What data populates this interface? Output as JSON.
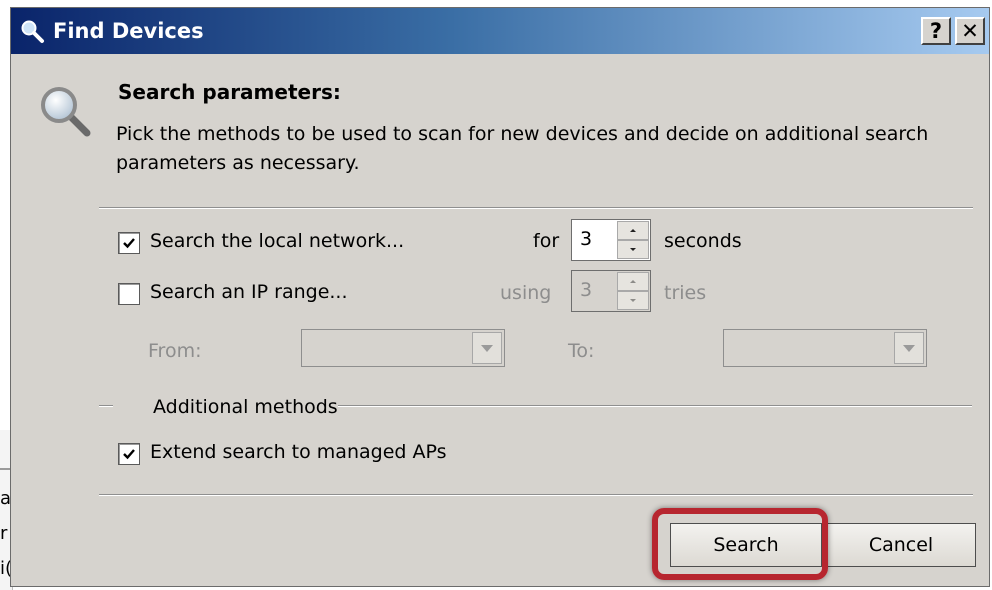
{
  "window": {
    "title": "Find Devices",
    "help_glyph": "?",
    "close_glyph": "✕"
  },
  "header": {
    "heading": "Search parameters:",
    "description": "Pick the methods to be used to scan for new devices and decide on additional search parameters as necessary."
  },
  "local_network": {
    "checked": true,
    "label": "Search the local network...",
    "for_label": "for",
    "value": "3",
    "unit": "seconds"
  },
  "ip_range": {
    "checked": false,
    "label": "Search an IP range...",
    "using_label": "using",
    "value": "3",
    "unit": "tries",
    "from_label": "From:",
    "to_label": "To:",
    "from_value": "",
    "to_value": ""
  },
  "additional": {
    "group_label": "Additional methods",
    "extend_checked": true,
    "extend_label": "Extend search to managed APs"
  },
  "buttons": {
    "search": "Search",
    "cancel": "Cancel"
  },
  "background_fragments": [
    "a",
    "r",
    "i("
  ],
  "colors": {
    "titlebar_start": "#0a246a",
    "titlebar_end": "#a6caf0",
    "dialog_bg": "#d6d3ce",
    "highlight": "#b7262f"
  }
}
